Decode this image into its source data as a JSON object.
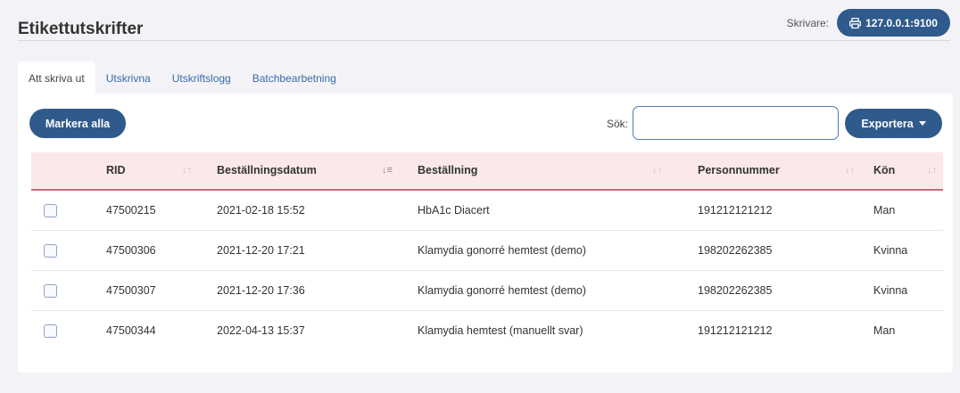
{
  "header": {
    "title": "Etikettutskrifter",
    "printer_label": "Skrivare:",
    "printer_value": "127.0.0.1:9100",
    "printer_icon": "printer-icon"
  },
  "tabs": [
    {
      "label": "Att skriva ut",
      "active": true
    },
    {
      "label": "Utskrivna",
      "active": false
    },
    {
      "label": "Utskriftslogg",
      "active": false
    },
    {
      "label": "Batchbearbetning",
      "active": false
    }
  ],
  "toolbar": {
    "select_all_label": "Markera alla",
    "search_label": "Sök:",
    "search_value": "",
    "export_label": "Exportera"
  },
  "table": {
    "columns": [
      "RID",
      "Beställningsdatum",
      "Beställning",
      "Personnummer",
      "Kön"
    ],
    "sorted_column": "Beställningsdatum",
    "rows": [
      {
        "checked": false,
        "cells": [
          "47500215",
          "2021-02-18 15:52",
          "HbA1c Diacert",
          "191212121212",
          "Man"
        ]
      },
      {
        "checked": false,
        "cells": [
          "47500306",
          "2021-12-20 17:21",
          "Klamydia gonorré hemtest (demo)",
          "198202262385",
          "Kvinna"
        ]
      },
      {
        "checked": false,
        "cells": [
          "47500307",
          "2021-12-20 17:36",
          "Klamydia gonorré hemtest (demo)",
          "198202262385",
          "Kvinna"
        ]
      },
      {
        "checked": false,
        "cells": [
          "47500344",
          "2022-04-13 15:37",
          "Klamydia hemtest (manuellt svar)",
          "191212121212",
          "Man"
        ]
      }
    ]
  },
  "colors": {
    "primary": "#2f5a8c",
    "header_row_bg": "#fbe9ea",
    "header_row_border": "#c76a79",
    "tab_link": "#3a6aa8"
  }
}
